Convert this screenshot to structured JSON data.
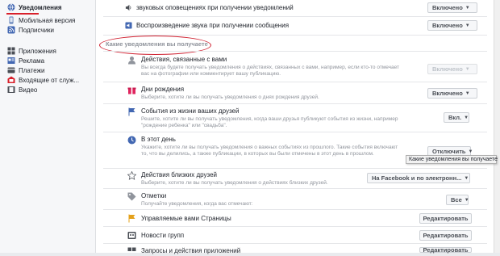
{
  "sidebar": {
    "items": [
      {
        "label": "Уведомления",
        "icon": "globe-icon"
      },
      {
        "label": "Мобильная версия",
        "icon": "mobile-icon"
      },
      {
        "label": "Подписчики",
        "icon": "rss-icon"
      },
      {
        "label": "Приложения",
        "icon": "apps-icon"
      },
      {
        "label": "Реклама",
        "icon": "ads-icon"
      },
      {
        "label": "Платежи",
        "icon": "card-icon"
      },
      {
        "label": "Входящие от служ...",
        "icon": "inbox-icon"
      },
      {
        "label": "Видео",
        "icon": "video-icon"
      }
    ]
  },
  "top_rows": [
    {
      "text": "звуковых оповещениях при получении уведомлений",
      "control": "Включено"
    },
    {
      "text": "Воспроизведение звука при получении сообщения",
      "control": "Включено"
    }
  ],
  "section": {
    "title": "Какие уведомления вы получаете"
  },
  "rows": [
    {
      "title": "Действия, связанные с вами",
      "desc": "Вы всегда будете получать уведомления о действиях, связанных с вами, например, если кто-то отмечает вас на фотографии или комментирует вашу публикацию.",
      "control": "Включено",
      "disabled": true
    },
    {
      "title": "Дни рождения",
      "desc": "Выберите, хотите ли вы получать уведомления о днях рождения друзей.",
      "control": "Включено"
    },
    {
      "title": "События из жизни ваших друзей",
      "desc": "Решите, хотите ли вы получать уведомления, когда ваши друзья публикуют события из жизни, например \"рождение ребенка\" или \"свадьба\".",
      "control": "Вкл."
    },
    {
      "title": "В этот день",
      "desc": "Укажите, хотите ли вы получать уведомления о важных событиях из прошлого. Такие события включают то, что вы делились, а также публикации, в которых вы были отмечены в этот день в прошлом.",
      "control": "Отключить"
    },
    {
      "title": "Действия близких друзей",
      "desc": "Выберите, хотите ли вы получать уведомления о действиях близких друзей.",
      "control": "На Facebook и по электронн..."
    },
    {
      "title": "Отметки",
      "desc": "Получайте уведомления, когда вас отмечают:",
      "control": "Все"
    }
  ],
  "edit_rows": [
    {
      "title": "Управляемые вами Страницы",
      "button": "Редактировать"
    },
    {
      "title": "Новости групп",
      "button": "Редактировать"
    },
    {
      "title": "Запросы и действия приложений",
      "button": "Редактировать"
    }
  ],
  "tooltip": "Какие уведомления вы получаете",
  "colors": {
    "accent": "#d8202b",
    "link": "#4267b2",
    "muted": "#90949c"
  }
}
